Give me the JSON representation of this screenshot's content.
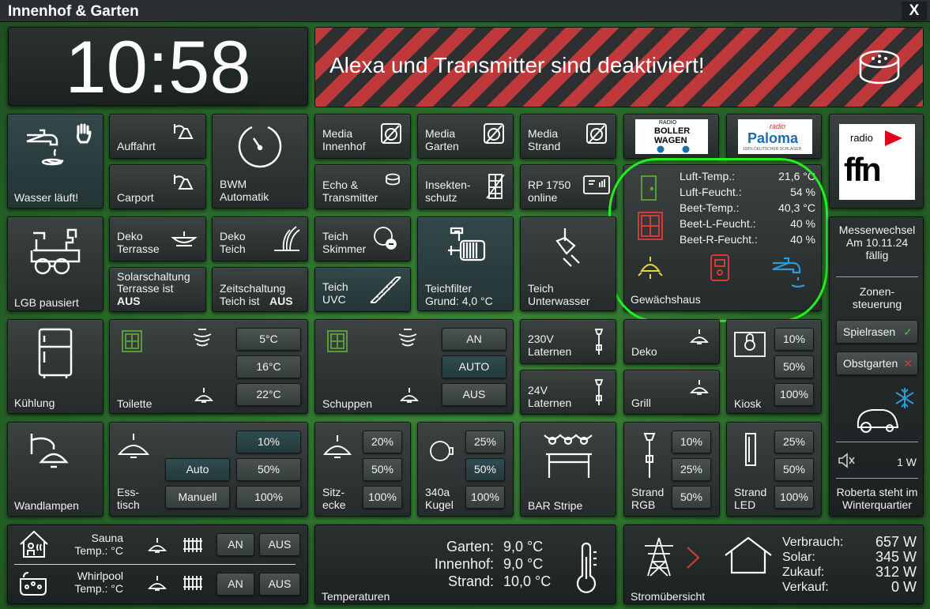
{
  "window": {
    "title": "Innenhof & Garten",
    "close": "X"
  },
  "clock": {
    "time": "10:58"
  },
  "banner": {
    "message": "Alexa und Transmitter sind deaktiviert!"
  },
  "tiles": {
    "wasser": "Wasser läuft!",
    "auffahrt": "Auffahrt",
    "carport": "Carport",
    "bwm1": "BWM",
    "bwm2": "Automatik",
    "media_innenhof1": "Media",
    "media_innenhof2": "Innenhof",
    "media_garten1": "Media",
    "media_garten2": "Garten",
    "media_strand1": "Media",
    "media_strand2": "Strand",
    "echo1": "Echo &",
    "echo2": "Transmitter",
    "insekten1": "Insekten-",
    "insekten2": "schutz",
    "rp1": "RP 1750",
    "rp2": "online",
    "lgb": "LGB pausiert",
    "deko_terrasse1": "Deko",
    "deko_terrasse2": "Terrasse",
    "deko_teich1": "Deko",
    "deko_teich2": "Teich",
    "solar1": "Solarschaltung",
    "solar2": "Terrasse ist",
    "solar3": "AUS",
    "zeit1": "Zeitschaltung",
    "zeit2": "Teich ist",
    "zeit3": "AUS",
    "skimmer1": "Teich",
    "skimmer2": "Skimmer",
    "uvc1": "Teich",
    "uvc2": "UVC",
    "teichfilter1": "Teichfilter",
    "teichfilter2": "Grund: 4,0 °C",
    "unterwasser1": "Teich",
    "unterwasser2": "Unterwasser",
    "kuehlung": "Kühlung",
    "toilette": "Toilette",
    "schuppen": "Schuppen",
    "laternen230_1": "230V",
    "laternen230_2": "Laternen",
    "laternen24_1": "24V",
    "laternen24_2": "Laternen",
    "deko": "Deko",
    "grill": "Grill",
    "kiosk": "Kiosk",
    "wandlampen": "Wandlampen",
    "esstisch1": "Ess-",
    "esstisch2": "tisch",
    "sitzecke1": "Sitz-",
    "sitzecke2": "ecke",
    "kugel1": "340a",
    "kugel2": "Kugel",
    "bar": "BAR Stripe",
    "strand_rgb1": "Strand",
    "strand_rgb2": "RGB",
    "strand_led1": "Strand",
    "strand_led2": "LED"
  },
  "buttons": {
    "toilette": [
      "5°C",
      "16°C",
      "22°C"
    ],
    "schuppen": [
      "AN",
      "AUTO",
      "AUS"
    ],
    "kiosk": [
      "10%",
      "50%",
      "100%"
    ],
    "esstisch": [
      "10%",
      "50%",
      "100%"
    ],
    "esstisch_mode": [
      "Auto",
      "Manuell"
    ],
    "sitzecke": [
      "20%",
      "50%",
      "100%"
    ],
    "kugel": [
      "25%",
      "50%",
      "100%"
    ],
    "strand_rgb": [
      "10%",
      "25%",
      "50%"
    ],
    "strand_led": [
      "25%",
      "50%",
      "100%"
    ]
  },
  "radios": {
    "boller_top": "RADIO",
    "boller1": "BOLLER",
    "boller2": "WAGEN",
    "paloma1": "radio",
    "paloma2": "Paloma",
    "paloma3": "100% DEUTSCHER SCHLAGER",
    "ffn1": "radio",
    "ffn2": "ffn"
  },
  "greenhouse": {
    "title": "Gewächshaus",
    "rows": [
      {
        "label": "Luft-Temp.:",
        "value": "21,6 °C"
      },
      {
        "label": "Luft-Feucht.:",
        "value": "54 %"
      },
      {
        "label": "Beet-Temp.:",
        "value": "40,3 °C"
      },
      {
        "label": "Beet-L-Feucht.:",
        "value": "40 %"
      },
      {
        "label": "Beet-R-Feucht.:",
        "value": "40 %"
      }
    ]
  },
  "sidebar": {
    "messer1": "Messerwechsel",
    "messer2": "Am 10.11.24",
    "messer3": "fällig",
    "zonen1": "Zonen-",
    "zonen2": "steuerung",
    "spielrasen": "Spielrasen",
    "obstgarten": "Obstgarten",
    "power": "1 W",
    "roberta1": "Roberta steht im",
    "roberta2": "Winterquartier"
  },
  "bottom": {
    "sauna1": "Sauna",
    "sauna2": "Temp.: °C",
    "whirlpool1": "Whirlpool",
    "whirlpool2": "Temp.: °C",
    "an": "AN",
    "aus": "AUS",
    "temperaturen": "Temperaturen",
    "temps": [
      {
        "label": "Garten:",
        "value": "9,0 °C"
      },
      {
        "label": "Innenhof:",
        "value": "9,0 °C"
      },
      {
        "label": "Strand:",
        "value": "10,0 °C"
      }
    ],
    "strom": "Stromübersicht",
    "power": [
      {
        "label": "Verbrauch:",
        "value": "657 W"
      },
      {
        "label": "Solar:",
        "value": "345 W"
      },
      {
        "label": "Zukauf:",
        "value": "312 W"
      },
      {
        "label": "Verkauf:",
        "value": "0 W"
      }
    ]
  },
  "colors": {
    "accent_green": "#22ee22",
    "red": "#d43a3a",
    "blue": "#2e9bd8",
    "yellow": "#e6d23a"
  }
}
